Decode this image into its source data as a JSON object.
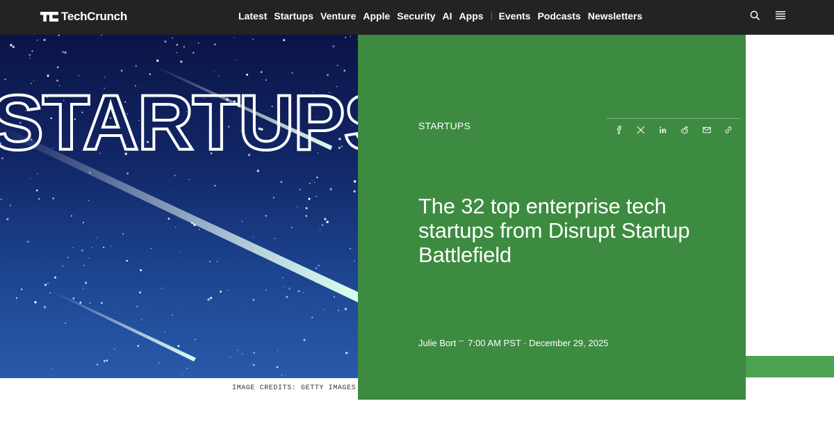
{
  "header": {
    "logo_text": "TechCrunch",
    "nav_primary": [
      "Latest",
      "Startups",
      "Venture",
      "Apple",
      "Security",
      "AI",
      "Apps"
    ],
    "nav_secondary": [
      "Events",
      "Podcasts",
      "Newsletters"
    ],
    "search_icon": "search-icon",
    "menu_icon": "hamburger-menu-icon"
  },
  "hero": {
    "image_word": "STARTUPS",
    "credits": "IMAGE CREDITS: GETTY IMAGES"
  },
  "article": {
    "category": "STARTUPS",
    "headline": "The 32 top enterprise tech startups from Disrupt Startup Battlefield",
    "author": "Julie Bort",
    "time": "7:00 AM PST · December 29, 2025",
    "share_icons": [
      "facebook-icon",
      "x-icon",
      "linkedin-icon",
      "reddit-icon",
      "email-icon",
      "link-icon"
    ]
  },
  "colors": {
    "header_bg": "#222322",
    "green_panel": "#3d8b40",
    "green_strip": "#4ba250",
    "sky_dark": "#0b1447",
    "sky_light": "#2a5aab"
  }
}
